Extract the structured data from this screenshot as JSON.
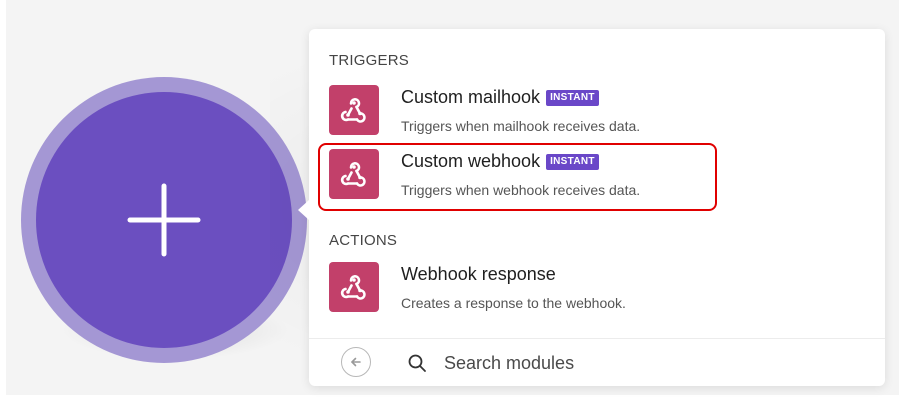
{
  "add_node": {
    "icon": "plus-icon",
    "color": "#6b4fc0",
    "ring_color": "#a497d4"
  },
  "panel": {
    "sections": [
      {
        "label": "TRIGGERS",
        "modules": [
          {
            "title": "Custom mailhook",
            "badge": "INSTANT",
            "description": "Triggers when mailhook receives data.",
            "icon": "webhook-icon"
          },
          {
            "title": "Custom webhook",
            "badge": "INSTANT",
            "description": "Triggers when webhook receives data.",
            "icon": "webhook-icon",
            "highlighted": true
          }
        ]
      },
      {
        "label": "ACTIONS",
        "modules": [
          {
            "title": "Webhook response",
            "description": "Creates a response to the webhook.",
            "icon": "webhook-icon"
          }
        ]
      }
    ],
    "search": {
      "placeholder": "Search modules",
      "back_icon": "arrow-left-circle-icon",
      "search_icon": "search-icon"
    }
  },
  "colors": {
    "module_icon_bg": "#c2406a",
    "badge_bg": "#6a47c8",
    "highlight_border": "#e00000"
  }
}
